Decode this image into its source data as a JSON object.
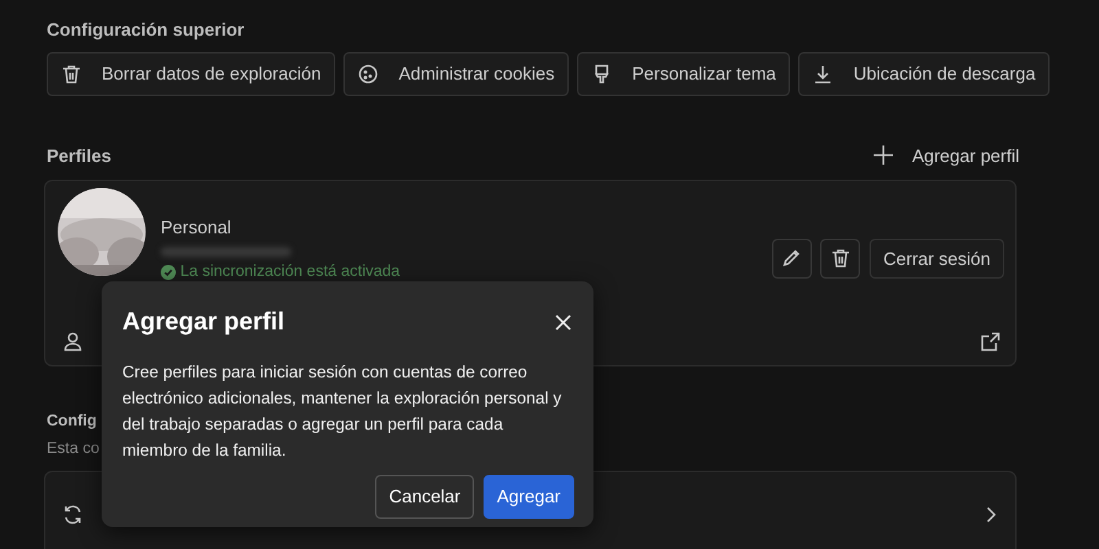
{
  "top_settings": {
    "title": "Configuración superior",
    "buttons": [
      {
        "label": "Borrar datos de exploración"
      },
      {
        "label": "Administrar cookies"
      },
      {
        "label": "Personalizar tema"
      },
      {
        "label": "Ubicación de descarga"
      }
    ]
  },
  "profiles": {
    "title": "Perfiles",
    "add_label": "Agregar perfil",
    "profile": {
      "name": "Personal",
      "email_blurred": true,
      "sync_status": "La sincronización está activada",
      "sign_out": "Cerrar sesión"
    }
  },
  "section": {
    "title": "Config",
    "subtitle": "Esta co"
  },
  "dialog": {
    "title": "Agregar perfil",
    "body": "Cree perfiles para iniciar sesión con cuentas de correo electrónico adicionales, mantener la exploración personal y del trabajo separadas o agregar un perfil para cada miembro de la familia.",
    "buttons": [
      {
        "label": "Cancelar",
        "primary": false
      },
      {
        "label": "Agregar",
        "primary": true
      }
    ]
  }
}
